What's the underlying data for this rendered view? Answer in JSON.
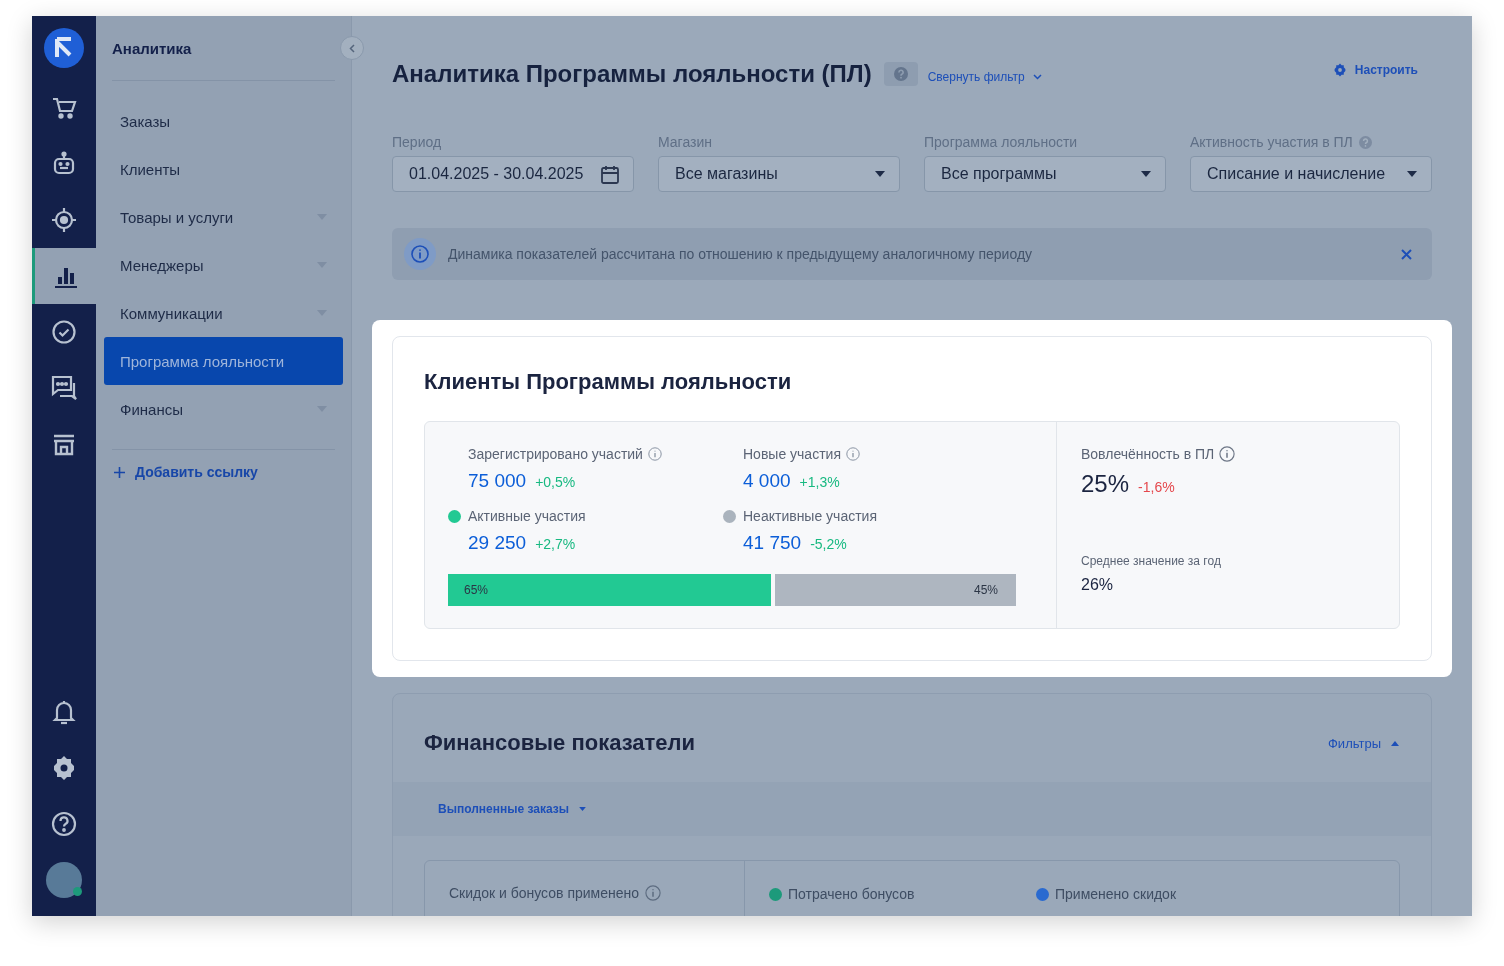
{
  "rail": [
    {
      "kind": "logo"
    },
    {
      "kind": "cart",
      "selected": false
    },
    {
      "kind": "robot",
      "selected": false
    },
    {
      "kind": "target",
      "selected": false
    },
    {
      "kind": "chart",
      "selected": true
    },
    {
      "kind": "check",
      "selected": false
    },
    {
      "kind": "chat",
      "selected": false
    },
    {
      "kind": "store",
      "selected": false
    }
  ],
  "rail_bottom": [
    {
      "kind": "bell"
    },
    {
      "kind": "gear"
    },
    {
      "kind": "help"
    },
    {
      "kind": "avatar",
      "online": true
    }
  ],
  "nav": {
    "title": "Аналитика",
    "items": [
      {
        "label": "Заказы",
        "expandable": false,
        "selected": false
      },
      {
        "label": "Клиенты",
        "expandable": false,
        "selected": false
      },
      {
        "label": "Товары и услуги",
        "expandable": true,
        "selected": false
      },
      {
        "label": "Менеджеры",
        "expandable": true,
        "selected": false
      },
      {
        "label": "Коммуникации",
        "expandable": true,
        "selected": false
      },
      {
        "label": "Программа лояльности",
        "expandable": false,
        "selected": true
      },
      {
        "label": "Финансы",
        "expandable": true,
        "selected": false
      }
    ],
    "add_link": "Добавить ссылку"
  },
  "header": {
    "title": "Аналитика Программы лояльности (ПЛ)",
    "collapse_filter": "Свернуть фильтр",
    "settings": "Настроить"
  },
  "filters": [
    {
      "label": "Период",
      "value": "01.04.2025 - 30.04.2025",
      "kind": "date",
      "help": false
    },
    {
      "label": "Магазин",
      "value": "Все магазины",
      "kind": "select",
      "help": false
    },
    {
      "label": "Программа лояльности",
      "value": "Все программы",
      "kind": "select",
      "help": false
    },
    {
      "label": "Активность участия в ПЛ",
      "value": "Списание и начисление",
      "kind": "select",
      "help": true
    }
  ],
  "banner": {
    "text": "Динамика показателей рассчитана по отношению к предыдущему аналогичному периоду"
  },
  "loyalty_card": {
    "title": "Клиенты Программы лояльности",
    "metrics": [
      {
        "label": "Зарегистрировано участий",
        "value": "75 000",
        "change": "+0,5%",
        "negative": false,
        "info": true
      },
      {
        "label": "Новые участия",
        "value": "4 000",
        "change": "+1,3%",
        "negative": false,
        "info": true
      },
      {
        "label": "Активные участия",
        "value": "29 250",
        "change": "+2,7%",
        "negative": false,
        "info": false,
        "color": "#22c993"
      },
      {
        "label": "Неактивные участия",
        "value": "41 750",
        "change": "-5,2%",
        "negative": false,
        "info": false,
        "color": "#aab3bd"
      }
    ],
    "bar": {
      "level": 0.575,
      "fill_label": "65%",
      "rest_label": "45%"
    },
    "engagement": {
      "label": "Вовлечённость в ПЛ",
      "value": "25%",
      "change": "-1,6%",
      "negative": true,
      "avg_label": "Среднее значение за год",
      "avg_value": "26%"
    }
  },
  "finance_card": {
    "title": "Финансовые показатели",
    "filters": "Фильтры",
    "dropdown": "Выполненные заказы",
    "metrics": [
      {
        "label": "Скидок и бонусов применено",
        "info": true
      },
      {
        "label": "Потрачено бонусов",
        "info": false,
        "color": "#1d9a7b"
      },
      {
        "label": "Применено скидок",
        "info": false,
        "color": "#2a6ad0"
      }
    ]
  }
}
